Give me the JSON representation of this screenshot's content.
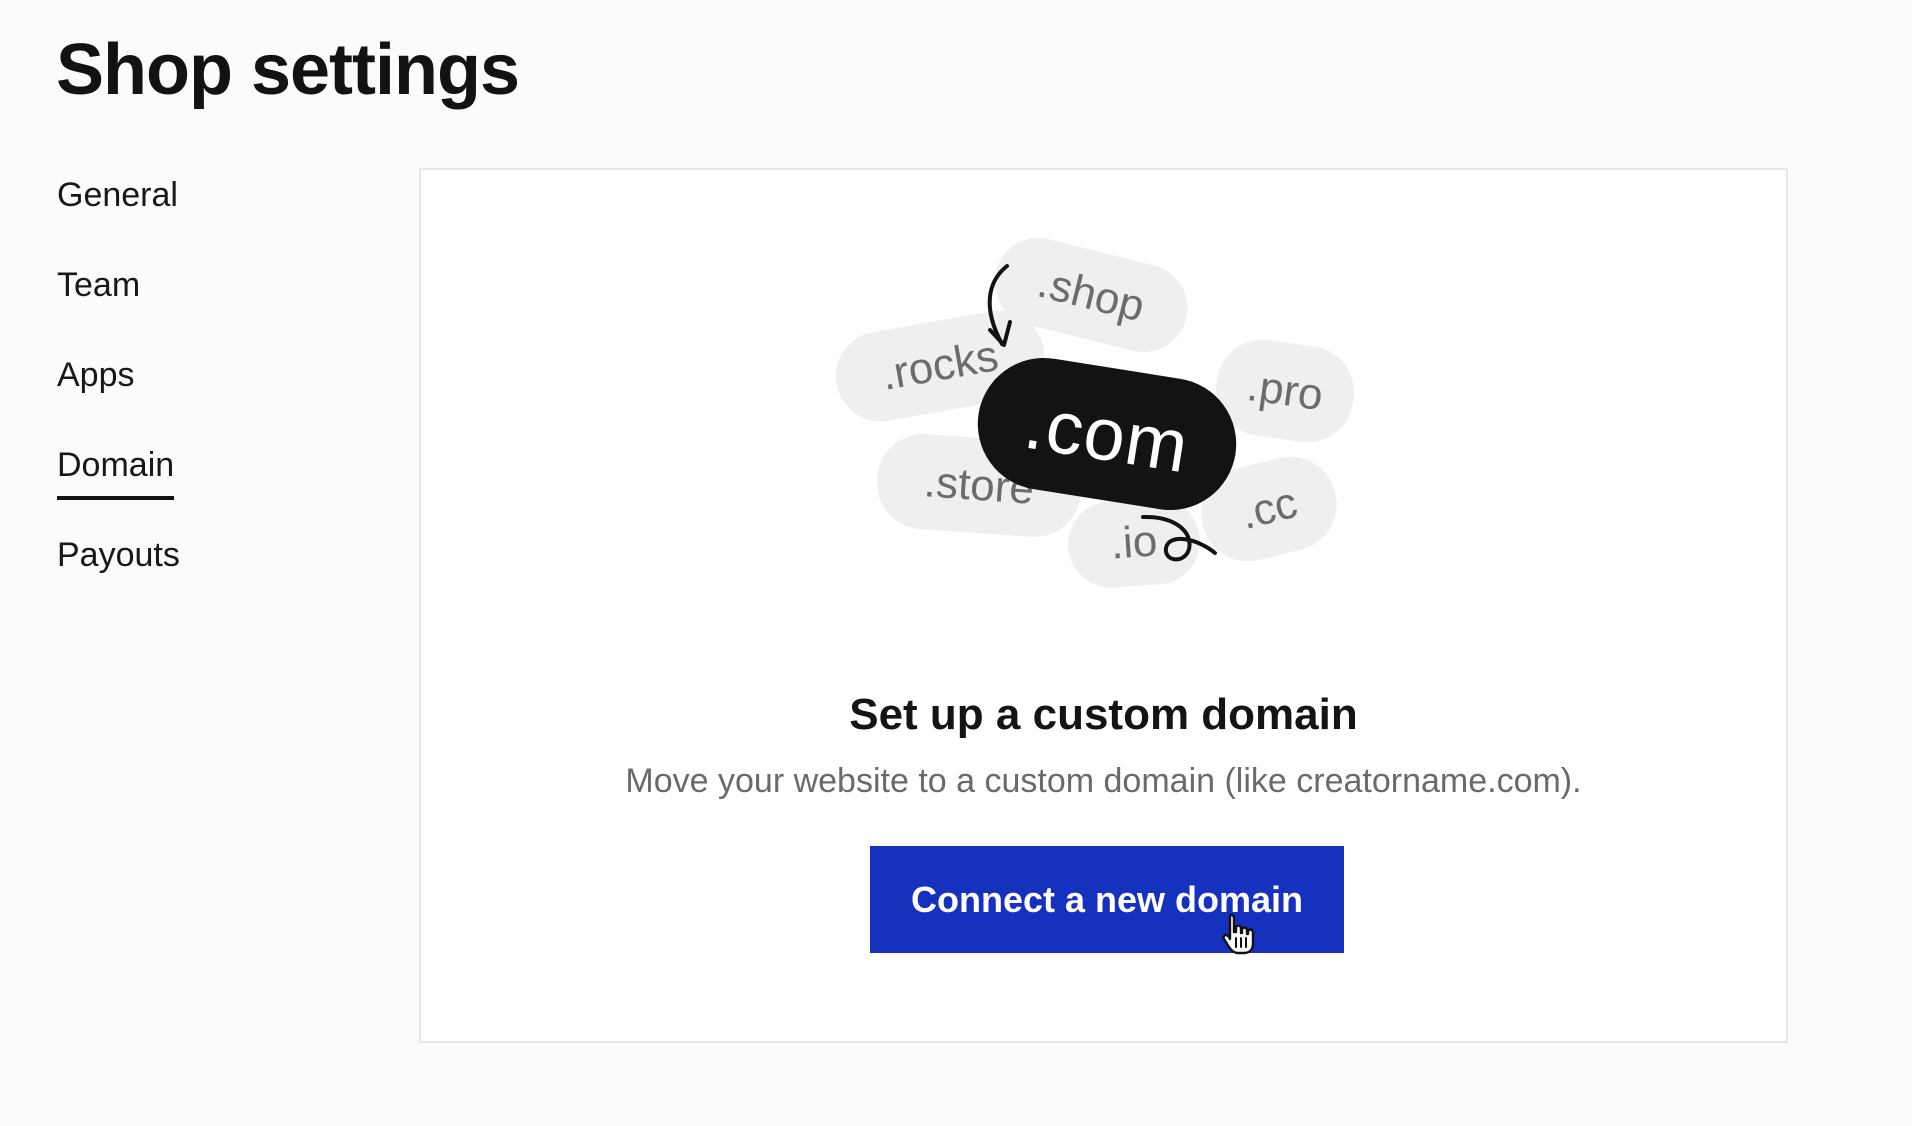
{
  "page": {
    "title": "Shop settings"
  },
  "sidebar": {
    "items": [
      {
        "label": "General",
        "active": false
      },
      {
        "label": "Team",
        "active": false
      },
      {
        "label": "Apps",
        "active": false
      },
      {
        "label": "Domain",
        "active": true
      },
      {
        "label": "Payouts",
        "active": false
      }
    ]
  },
  "illustration": {
    "main_tld": ".com",
    "tlds": [
      ".shop",
      ".rocks",
      ".pro",
      ".store",
      ".cc",
      ".io"
    ]
  },
  "domain_panel": {
    "title": "Set up a custom domain",
    "description": "Move your website to a custom domain (like creatorname.com).",
    "button_label": "Connect a new domain"
  },
  "colors": {
    "background": "#fbfbf9",
    "panel": "#ffffff",
    "primary_button": "#1631bd",
    "pill": "#efefee",
    "main_pill": "#131313"
  },
  "icons": {
    "cursor": "hand-pointer-icon",
    "arrow": "curved-arrow-icon",
    "squiggle": "loop-squiggle-icon"
  }
}
